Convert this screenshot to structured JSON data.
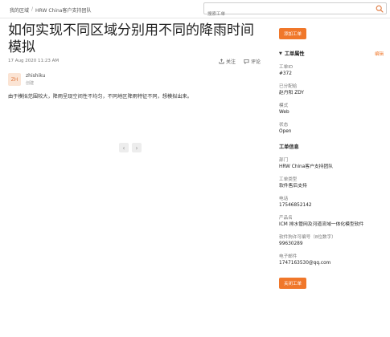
{
  "breadcrumb": {
    "items": [
      "我的区域",
      "HRW China客户支持团队"
    ],
    "separator": "/"
  },
  "search": {
    "placeholder": "搜索工单",
    "icon": "search-icon"
  },
  "ticket": {
    "title": "如何实现不同区域分别用不同的降雨时间模拟",
    "date": "17 Aug 2020 11:23 AM",
    "actions": {
      "follow_label": "关注",
      "comment_label": "评论"
    },
    "author": {
      "initials": "ZH",
      "name": "zhishiku",
      "sub": "创建"
    },
    "body": "由于模拟范围较大，降雨呈现空间性不均匀，不同地区降雨特征不同，想模拟出来。"
  },
  "carousel": {
    "prev": "‹",
    "next": "›"
  },
  "sidebar": {
    "add_ticket_label": "添加工单",
    "properties": {
      "title": "工单属性",
      "edit_label": "编辑",
      "fields": [
        {
          "label": "工单ID",
          "value": "#372"
        },
        {
          "label": "已分配给",
          "value": "赵丹阳 ZDY"
        },
        {
          "label": "模式",
          "value": "Web"
        },
        {
          "label": "状态",
          "value": "Open"
        }
      ]
    },
    "info": {
      "title": "工单信息",
      "fields": [
        {
          "label": "部门",
          "value": "HRW China客户支持团队"
        },
        {
          "label": "工单类型",
          "value": "软件售后支持"
        },
        {
          "label": "电话",
          "value": "17546852142"
        },
        {
          "label": "产品名",
          "value": "ICM 排水管网及河道流域一体化模型软件"
        },
        {
          "label": "软件狗许可编号（8位数字）",
          "value": "99630289"
        },
        {
          "label": "电子邮件",
          "value": "1747163530@qq.com"
        }
      ]
    },
    "close_ticket_label": "关闭工单"
  },
  "colors": {
    "accent": "#f0772a",
    "avatar_bg": "#fbe4d4"
  }
}
